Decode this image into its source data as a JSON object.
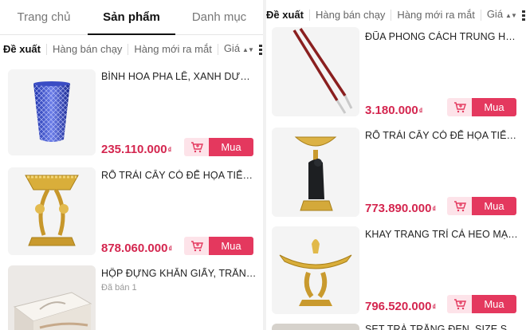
{
  "left": {
    "tabs": [
      {
        "label": "Trang chủ",
        "active": false
      },
      {
        "label": "Sản phẩm",
        "active": true
      },
      {
        "label": "Danh mục",
        "active": false
      }
    ],
    "filters": {
      "recommended": "Đề xuất",
      "best_selling": "Hàng bán chạy",
      "new_arrivals": "Hàng mới ra mắt",
      "price": "Giá"
    },
    "products": [
      {
        "name": "BÌNH HOA PHA LÊ, XANH DƯƠNG,...",
        "price": "235.110.000",
        "currency": "₫",
        "buy": "Mua",
        "image": "blue-crystal-vase"
      },
      {
        "name": "RỔ TRÁI CÂY CÓ ĐẾ HỌA TIẾT SƯ...",
        "price": "878.060.000",
        "currency": "₫",
        "buy": "Mua",
        "image": "gold-fruit-basket"
      },
      {
        "name": "HỘP ĐỰNG KHĂN GIẤY, TRẮNG NG...",
        "sold": "Đã bán 1",
        "image": "white-tissue-box"
      }
    ]
  },
  "right": {
    "filters": {
      "recommended": "Đề xuất",
      "best_selling": "Hàng bán chạy",
      "new_arrivals": "Hàng mới ra mắt",
      "price": "Giá"
    },
    "products": [
      {
        "name": "ĐŨA PHONG CÁCH TRUNG HOA, M...",
        "price": "3.180.000",
        "currency": "₫",
        "buy": "Mua",
        "image": "red-silver-chopsticks"
      },
      {
        "name": "RỔ TRÁI CÂY CÓ ĐẾ HỌA TIẾT QU...",
        "price": "773.890.000",
        "currency": "₫",
        "buy": "Mua",
        "image": "gold-eagle-fruit-bowl"
      },
      {
        "name": "KHAY TRANG TRÍ CÁ HEO MẠ VÀN...",
        "price": "796.520.000",
        "currency": "₫",
        "buy": "Mua",
        "image": "gold-dolphin-tray"
      },
      {
        "name": "SET TRÀ TRẮNG ĐEN, SIZE S, CHO...",
        "image": "tea-set"
      }
    ]
  },
  "icons": {
    "cart": "add-to-cart-icon",
    "view": "view-toggle-icon",
    "sort": "sort-arrows-icon"
  },
  "colors": {
    "price": "#d4264f",
    "buy_button": "#e4385e",
    "cart_button_bg": "#fde3e9",
    "text": "#222222",
    "muted": "#777777"
  }
}
